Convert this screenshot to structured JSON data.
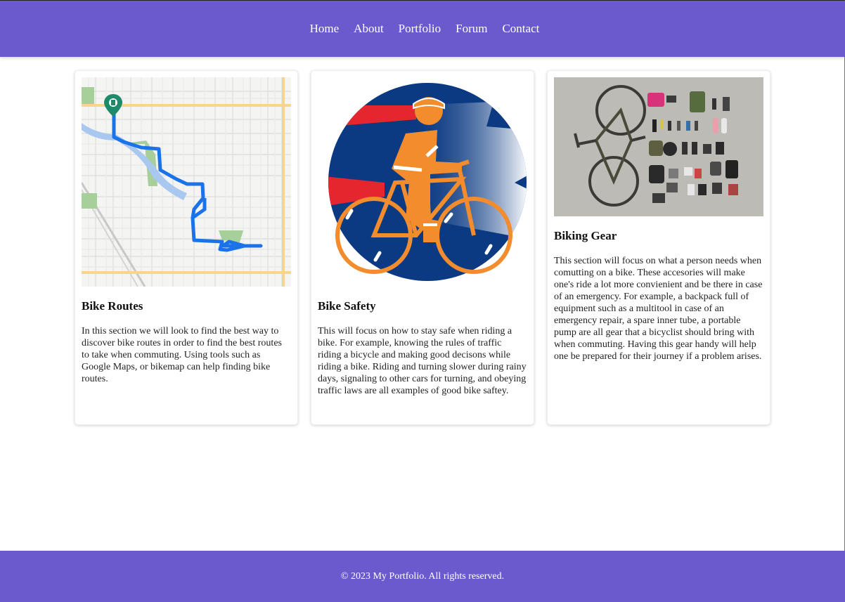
{
  "nav": {
    "items": [
      "Home",
      "About",
      "Portfolio",
      "Forum",
      "Contact"
    ]
  },
  "cards": [
    {
      "image": "map-route-image",
      "title": "Bike Routes",
      "text": "In this section we will look to find the best way to discover bike routes in order to find the best routes to take when commuting. Using tools such as Google Maps, or bikemap can help finding bike routes."
    },
    {
      "image": "bike-safety-illustration",
      "title": "Bike Safety",
      "text": "This will focus on how to stay safe when riding a bike. For example, knowing the rules of traffic riding a bicycle and making good decisons while riding a bike. Riding and turning slower during rainy days, signaling to other cars for turning, and obeying traffic laws are all examples of good bike saftey."
    },
    {
      "image": "biking-gear-photo",
      "title": "Biking Gear",
      "text": "This section will focus on what a person needs when comutting on a bike. These accesories will make one's ride a lot more convienient and be there in case of an emergency. For example, a backpack full of equipment such as a multitool in case of an emergency repair, a spare inner tube, a portable pump are all gear that a bicyclist should bring with when commuting. Having this gear handy will help one be prepared for their journey if a problem arises."
    }
  ],
  "footer": {
    "copyright": "© 2023 My Portfolio. All rights reserved."
  },
  "colors": {
    "header_bg": "#6a5acd",
    "footer_bg": "#6a5acd",
    "route_blue": "#1a73e8",
    "safety_navy": "#0b3a82",
    "safety_orange": "#f28c2c"
  }
}
